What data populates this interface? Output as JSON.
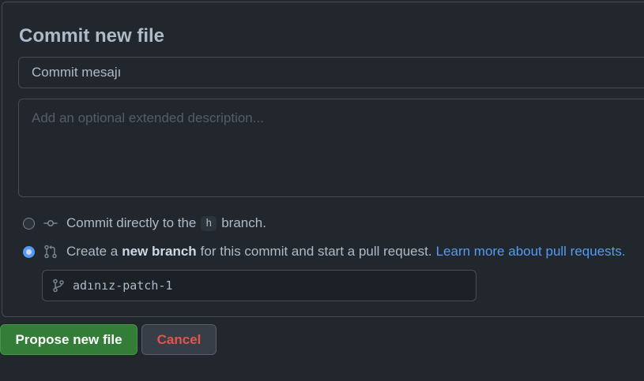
{
  "commit_panel": {
    "title": "Commit new file",
    "summary_value": "Commit mesajı",
    "description_placeholder": "Add an optional extended description..."
  },
  "options": {
    "direct": {
      "text_before": "Commit directly to the",
      "branch_name": "h",
      "text_after": "branch.",
      "selected": false
    },
    "new_branch": {
      "text_before": "Create a",
      "bold_text": "new branch",
      "text_after": "for this commit and start a pull request.",
      "link_text": "Learn more about pull requests.",
      "selected": true
    }
  },
  "branch_name_input": {
    "value": "adınız-patch-1",
    "icon": "git-branch-icon"
  },
  "buttons": {
    "propose_label": "Propose new file",
    "cancel_label": "Cancel"
  },
  "colors": {
    "primary_button": "#347d39",
    "cancel_text": "#e5534b",
    "link": "#539bf5"
  }
}
